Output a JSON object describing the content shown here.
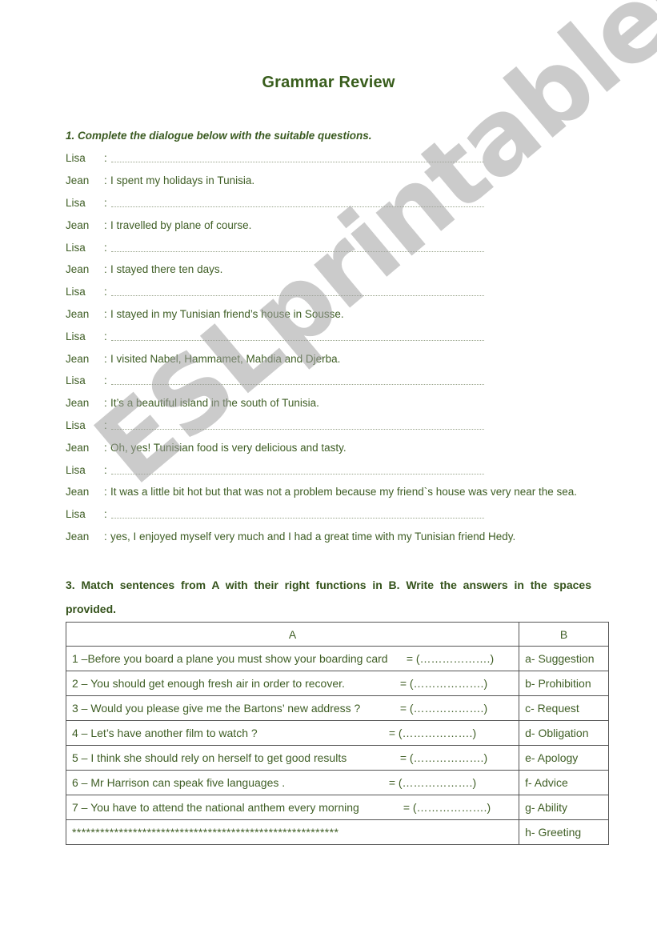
{
  "document": {
    "title": "Grammar Review",
    "watermark": "ESLprintables.com"
  },
  "section1": {
    "heading": "1. Complete the dialogue below with the suitable questions.",
    "lines": [
      {
        "speaker": "Lisa",
        "text": ""
      },
      {
        "speaker": "Jean",
        "text": "I spent my holidays in Tunisia."
      },
      {
        "speaker": "Lisa",
        "text": ""
      },
      {
        "speaker": "Jean",
        "text": "I travelled by plane of course."
      },
      {
        "speaker": "Lisa",
        "text": ""
      },
      {
        "speaker": "Jean",
        "text": "I stayed there ten days."
      },
      {
        "speaker": "Lisa",
        "text": ""
      },
      {
        "speaker": "Jean",
        "text": "I stayed in my Tunisian friend’s house in Sousse."
      },
      {
        "speaker": "Lisa",
        "text": ""
      },
      {
        "speaker": "Jean",
        "text": "I visited Nabel, Hammamet, Mahdia and Djerba."
      },
      {
        "speaker": "Lisa",
        "text": ""
      },
      {
        "speaker": "Jean",
        "text": "It’s a beautiful island in the south of Tunisia."
      },
      {
        "speaker": "Lisa",
        "text": ""
      },
      {
        "speaker": "Jean",
        "text": "Oh, yes! Tunisian food is very delicious and tasty."
      },
      {
        "speaker": "Lisa",
        "text": ""
      },
      {
        "speaker": "Jean",
        "text": "It was a little bit hot but that was not a problem because my friend`s house was very near the sea."
      },
      {
        "speaker": "Lisa",
        "text": ""
      },
      {
        "speaker": "Jean",
        "text": "yes, I enjoyed myself very much and I had a great time with my Tunisian friend Hedy."
      }
    ]
  },
  "section3": {
    "heading": "3. Match sentences from A with their right functions in B. Write the answers in the spaces provided.",
    "col_a_header": "A",
    "col_b_header": "B",
    "rows": [
      {
        "a": "1 –Before you board a plane you must show your boarding card",
        "answer": "= (……………….)",
        "b": "a- Suggestion"
      },
      {
        "a": "2 – You should get enough fresh air in order to recover.",
        "answer": "= (……………….)",
        "b": "b- Prohibition"
      },
      {
        "a": "3 – Would you please give me the Bartons’ new address ?",
        "answer": "= (……………….)",
        "b": "c- Request"
      },
      {
        "a": "4 – Let’s have another film to watch ?",
        "answer": "= (……………….)",
        "b": "d- Obligation"
      },
      {
        "a": "5 – I think she should rely on herself to get good results",
        "answer": "= (……………….)",
        "b": "e- Apology"
      },
      {
        "a": "6 – Mr Harrison can speak five languages .",
        "answer": "= (……………….)",
        "b": "f-  Advice"
      },
      {
        "a": "7 – You have to attend the national anthem every morning",
        "answer": "= (……………….)",
        "b": "g- Ability"
      },
      {
        "a": "*********************************************************",
        "answer": "",
        "b": "h- Greeting"
      }
    ]
  }
}
